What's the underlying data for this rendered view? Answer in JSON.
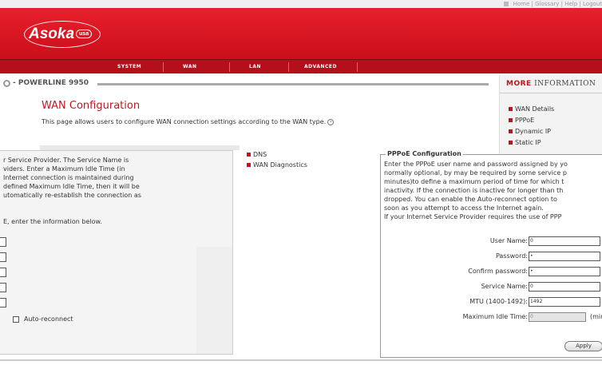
{
  "toplinks": [
    "Home",
    "Glossary",
    "Help",
    "Logout"
  ],
  "brand": {
    "name": "Asoka",
    "region": "usa"
  },
  "nav": [
    "SYSTEM",
    "WAN",
    "LAN",
    "ADVANCED"
  ],
  "product": "POWERLINE 9950",
  "page": {
    "title": "WAN Configuration",
    "description": "This page allows users to configure WAN connection settings according to the WAN type."
  },
  "more_info": {
    "title_bold": "MORE",
    "title_rest": "INFORMATION",
    "items": [
      "WAN Details",
      "PPPoE",
      "Dynamic IP",
      "Static IP"
    ]
  },
  "left_panel": {
    "text_lines": [
      "r Service Provider. The Service Name is",
      "viders. Enter a Maximum Idle Time (in",
      "Internet connection is maintained during",
      "defined Maximum Idle Time, then it will be",
      "utomatically re-establish the connection as"
    ],
    "text2": "E, enter the information below.",
    "auto_reconnect_label": "Auto-reconnect"
  },
  "links": [
    "DNS",
    "WAN Diagnostics"
  ],
  "pppoe": {
    "legend": "PPPoE Configuration",
    "text_lines": [
      "Enter the PPPoE user name and password assigned by yo",
      "normally optional, by may be required by some service p",
      "minutes)to define a maximum period of time for which t",
      "inactivity. If the connection is inactive for longer than th",
      "dropped. You can enable the Auto-reconnect option to",
      "soon as you attempt to access the Internet again.",
      "If your Internet Service Provider requires the use of PPP"
    ],
    "fields": {
      "user_name": {
        "label": "User Name:",
        "value": "0"
      },
      "password": {
        "label": "Password:",
        "value": "•"
      },
      "confirm_password": {
        "label": "Confirm password:",
        "value": "•"
      },
      "service_name": {
        "label": "Service Name:",
        "value": "0"
      },
      "mtu": {
        "label": "MTU (1400-1492):",
        "value": "1492"
      },
      "max_idle": {
        "label": "Maximum Idle Time:",
        "value": "0",
        "unit": "(minutes"
      }
    },
    "apply_label": "Apply"
  }
}
